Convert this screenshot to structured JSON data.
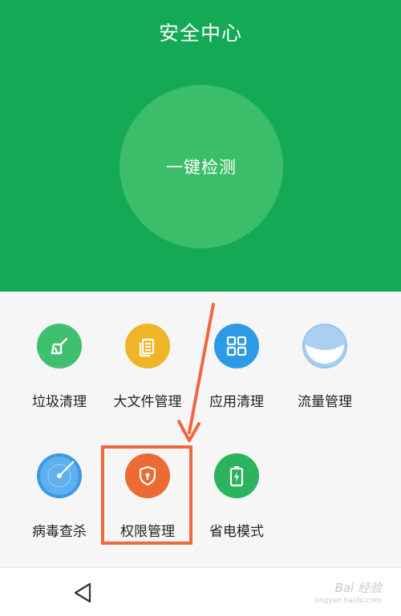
{
  "header": {
    "title": "安全中心",
    "bg_color": "#14a955"
  },
  "scan_button": {
    "label": "一键检测",
    "color": "#3bbd69"
  },
  "tools": [
    {
      "label": "垃圾清理",
      "icon": "broom-icon",
      "color": "#3fc06e"
    },
    {
      "label": "大文件管理",
      "icon": "document-icon",
      "color": "#f1b427"
    },
    {
      "label": "应用清理",
      "icon": "app-grid-icon",
      "color": "#2d9ae6"
    },
    {
      "label": "流量管理",
      "icon": "data-usage-icon",
      "color": "#96c4ee"
    },
    {
      "label": "病毒查杀",
      "icon": "radar-icon",
      "color": "#3b98e3"
    },
    {
      "label": "权限管理",
      "icon": "shield-lock-icon",
      "color": "#ec6a33"
    },
    {
      "label": "省电模式",
      "icon": "battery-icon",
      "color": "#2bb35d"
    }
  ],
  "nav": {
    "back_icon": "back-triangle-icon"
  },
  "annotation": {
    "color": "#f0683f"
  },
  "watermark": {
    "brand": "Bai 经验",
    "url": "jingyan.baidu.com"
  }
}
